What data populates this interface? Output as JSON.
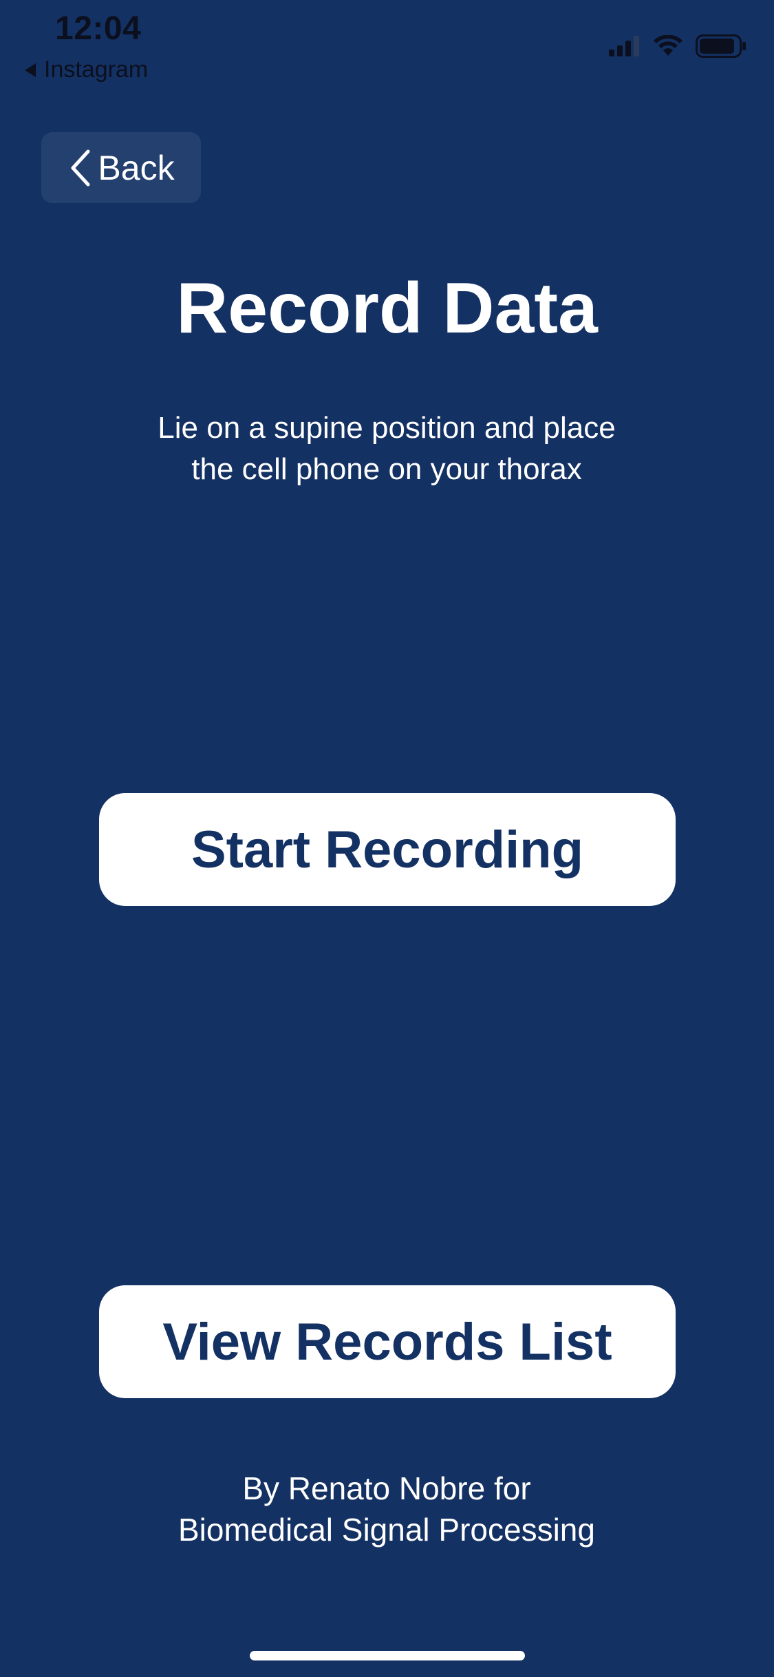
{
  "status_bar": {
    "time": "12:04",
    "back_app_label": "Instagram"
  },
  "nav": {
    "back_label": "Back"
  },
  "main": {
    "title": "Record Data",
    "instructions": [
      "Lie on a supine position and place",
      "the cell phone on your thorax"
    ],
    "start_button_label": "Start Recording",
    "records_button_label": "View Records List"
  },
  "footer": {
    "credit_lines": [
      "By Renato Nobre for",
      "Biomedical Signal Processing"
    ]
  },
  "colors": {
    "background": "#143163",
    "button_text": "#143163",
    "button_bg": "#FFFFFF",
    "back_button_bg": "#24406F"
  },
  "icons": {
    "signal": "signal-icon",
    "wifi": "wifi-icon",
    "battery": "battery-icon",
    "back": "chevron-left-icon"
  }
}
